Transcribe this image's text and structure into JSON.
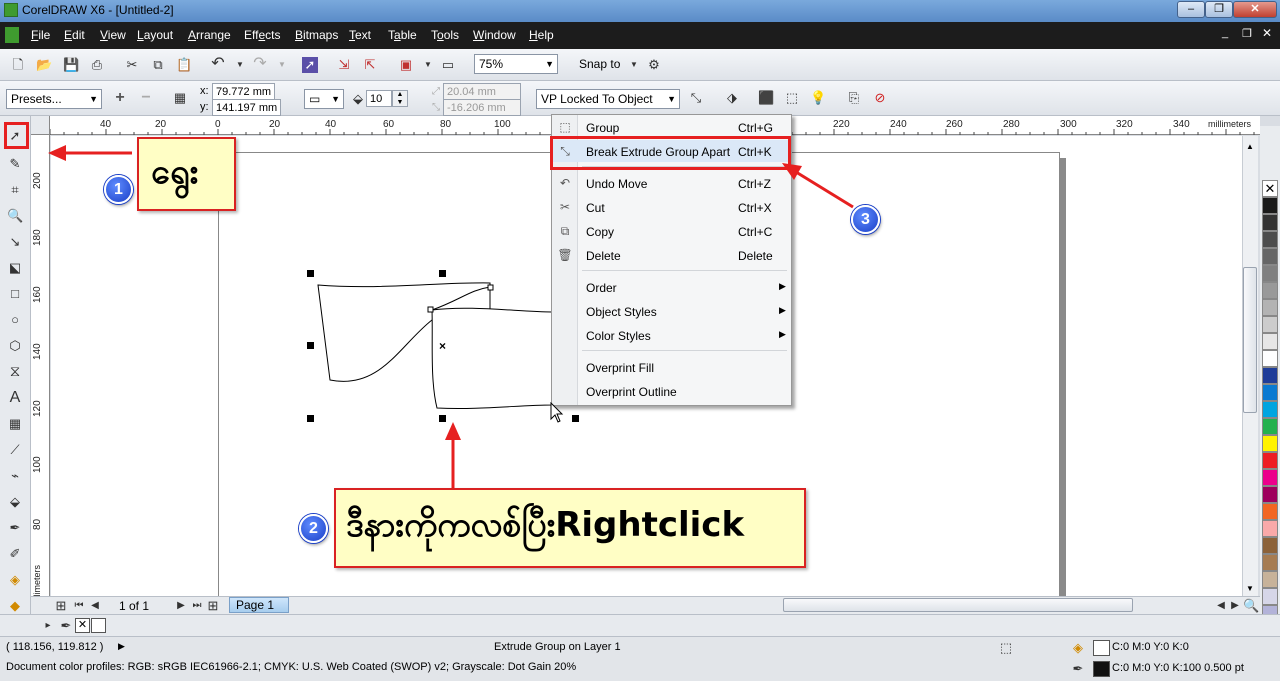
{
  "window": {
    "title": "CorelDRAW X6 - [Untitled-2]"
  },
  "menu": [
    {
      "pre": "",
      "u": "F",
      "post": "ile"
    },
    {
      "pre": "",
      "u": "E",
      "post": "dit"
    },
    {
      "pre": "",
      "u": "V",
      "post": "iew"
    },
    {
      "pre": "",
      "u": "L",
      "post": "ayout"
    },
    {
      "pre": "",
      "u": "A",
      "post": "rrange"
    },
    {
      "pre": "Eff",
      "u": "e",
      "post": "cts"
    },
    {
      "pre": "",
      "u": "B",
      "post": "itmaps"
    },
    {
      "pre": "",
      "u": "T",
      "post": "ext"
    },
    {
      "pre": "T",
      "u": "a",
      "post": "ble"
    },
    {
      "pre": "T",
      "u": "o",
      "post": "ols"
    },
    {
      "pre": "",
      "u": "W",
      "post": "indow"
    },
    {
      "pre": "",
      "u": "H",
      "post": "elp"
    }
  ],
  "toolbar": {
    "zoom": "75%",
    "snap_to": "Snap to"
  },
  "propbar": {
    "presets": "Presets...",
    "x_label": "x:",
    "x_value": "79.772 mm",
    "y_label": "y:",
    "y_value": "141.197 mm",
    "depth": "10",
    "vp_x": "20.04 mm",
    "vp_y": "-16.206 mm",
    "vp_mode": "VP Locked To Object"
  },
  "ruler": {
    "h_ticks": [
      "40",
      "20",
      "0",
      "20",
      "40",
      "60",
      "80",
      "100",
      "220",
      "240",
      "260",
      "280",
      "300",
      "320",
      "340"
    ],
    "units": "millimeters",
    "v_ticks": [
      "200",
      "180",
      "160",
      "140",
      "120",
      "100",
      "80"
    ],
    "v_units": "millimeters"
  },
  "context_menu": {
    "items": [
      {
        "label": "Group",
        "shortcut": "Ctrl+G"
      },
      {
        "label": "Break Extrude Group Apart",
        "shortcut": "Ctrl+K"
      },
      {
        "label": "Undo Move",
        "shortcut": "Ctrl+Z"
      },
      {
        "label": "Cut",
        "shortcut": "Ctrl+X"
      },
      {
        "label": "Copy",
        "shortcut": "Ctrl+C"
      },
      {
        "label": "Delete",
        "shortcut": "Delete"
      },
      {
        "label": "Order",
        "shortcut": ""
      },
      {
        "label": "Object Styles",
        "shortcut": ""
      },
      {
        "label": "Color Styles",
        "shortcut": ""
      },
      {
        "label": "Overprint Fill",
        "shortcut": ""
      },
      {
        "label": "Overprint Outline",
        "shortcut": ""
      }
    ]
  },
  "callouts": {
    "c1_num": "1",
    "c1_text": "ရွေး",
    "c2_num": "2",
    "c2_text": "ဒီနားကိုကလစ်ပြီးRightclick",
    "c3_num": "3"
  },
  "nav": {
    "page_count": "1 of 1",
    "page_tab": "Page 1"
  },
  "status": {
    "coords": "( 118.156, 119.812 )",
    "layer": "Extrude Group on Layer 1",
    "fill": "C:0 M:0 Y:0 K:0",
    "outline": "C:0 M:0 Y:0 K:100  0.500 pt",
    "profiles": "Document color profiles: RGB: sRGB IEC61966-2.1; CMYK: U.S. Web Coated (SWOP) v2; Grayscale: Dot Gain 20%"
  },
  "palette": [
    "#ffffff",
    "#1a1a1a",
    "#333333",
    "#4d4d4d",
    "#666666",
    "#808080",
    "#999999",
    "#b3b3b3",
    "#cccccc",
    "#e6e6e6",
    "#ffffff",
    "#1f3d99",
    "#0a7ad1",
    "#00a5e0",
    "#23b14d",
    "#fff200",
    "#ed1c24",
    "#ec008c",
    "#9e005d",
    "#f26522",
    "#f9a9a9",
    "#8c6239",
    "#a67c52",
    "#c7b299",
    "#d6d6e8",
    "#b3b3d9"
  ]
}
